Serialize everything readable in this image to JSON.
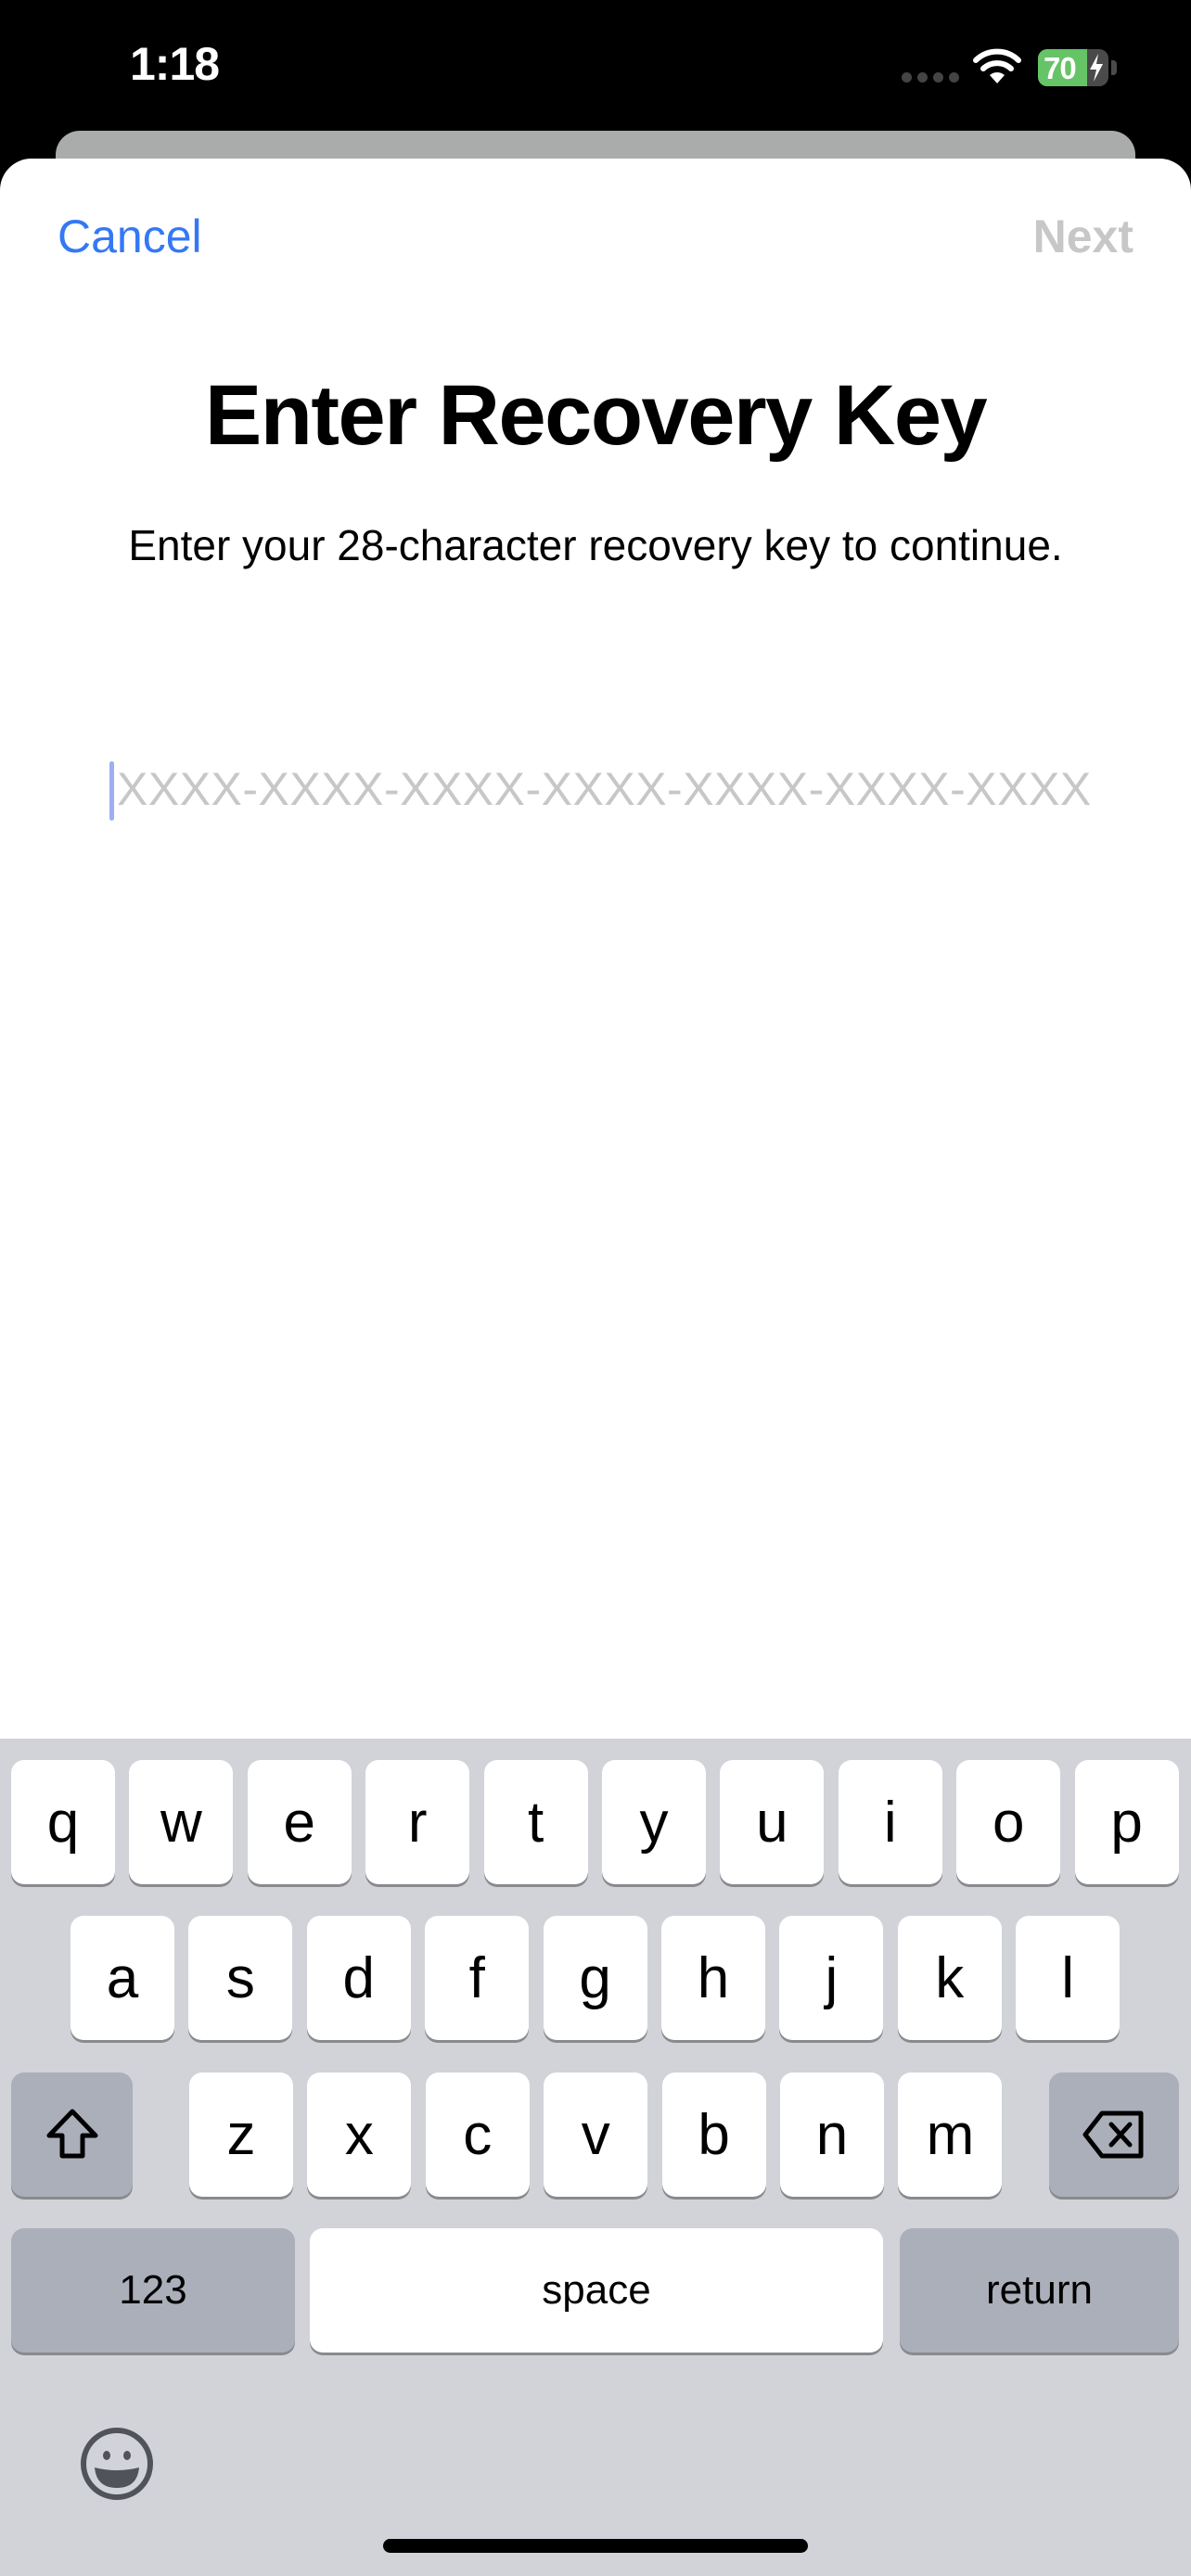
{
  "status_bar": {
    "time": "1:18",
    "battery_percent": 70,
    "battery_label": "70",
    "charging": true,
    "icons": [
      "signal-dots-icon",
      "wifi-icon",
      "battery-icon",
      "charging-bolt-icon"
    ]
  },
  "nav": {
    "cancel_label": "Cancel",
    "next_label": "Next",
    "next_enabled": false
  },
  "content": {
    "title": "Enter Recovery Key",
    "subtitle": "Enter your 28-character recovery key to continue.",
    "key_input": {
      "value": "",
      "placeholder": "XXXX-XXXX-XXXX-XXXX-XXXX-XXXX-XXXX"
    }
  },
  "keyboard": {
    "row1": [
      "q",
      "w",
      "e",
      "r",
      "t",
      "y",
      "u",
      "i",
      "o",
      "p"
    ],
    "row2": [
      "a",
      "s",
      "d",
      "f",
      "g",
      "h",
      "j",
      "k",
      "l"
    ],
    "row3": [
      "z",
      "x",
      "c",
      "v",
      "b",
      "n",
      "m"
    ],
    "shift_icon": "shift-icon",
    "delete_icon": "delete-icon",
    "numbers_label": "123",
    "space_label": "space",
    "return_label": "return",
    "emoji_icon": "emoji-icon"
  },
  "colors": {
    "accent": "#3478F6",
    "disabled": "#C7C7C7",
    "battery_green": "#65C466",
    "keyboard_bg": "#D1D3D9",
    "function_key": "#ABAFBA"
  }
}
